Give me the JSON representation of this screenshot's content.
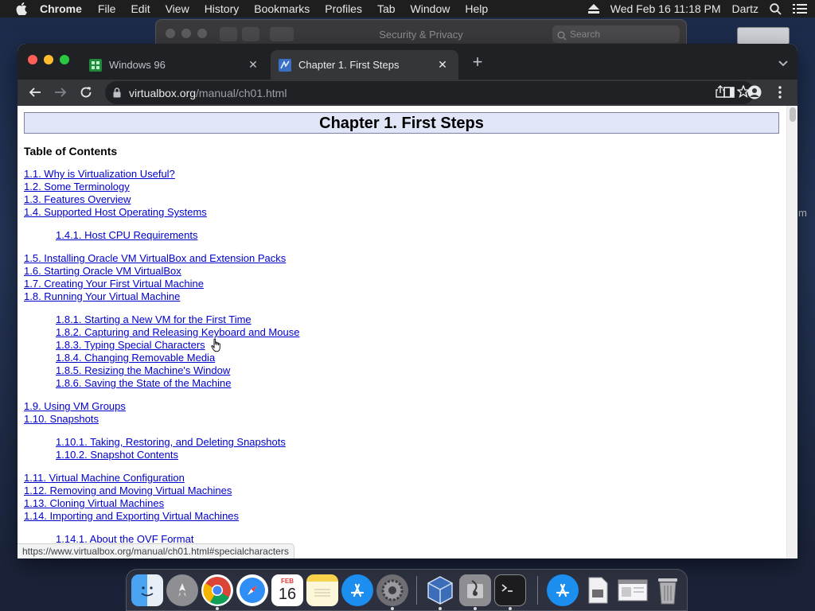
{
  "menubar": {
    "app_name": "Chrome",
    "menus": [
      "File",
      "Edit",
      "View",
      "History",
      "Bookmarks",
      "Profiles",
      "Tab",
      "Window",
      "Help"
    ],
    "datetime": "Wed Feb 16  11:18 PM",
    "user": "Dartz"
  },
  "background_window": {
    "title": "Security & Privacy",
    "search_placeholder": "Search"
  },
  "desktop": {
    "partial_text": "m"
  },
  "browser": {
    "tabs": [
      {
        "label": "Windows 96",
        "active": false
      },
      {
        "label": "Chapter 1. First Steps",
        "active": true
      }
    ],
    "url_host": "virtualbox.org",
    "url_path": "/manual/ch01.html",
    "status_url": "https://www.virtualbox.org/manual/ch01.html#specialcharacters"
  },
  "page": {
    "title": "Chapter 1. First Steps",
    "toc_heading": "Table of Contents",
    "toc": {
      "g1": [
        "1.1. Why is Virtualization Useful?",
        "1.2. Some Terminology",
        "1.3. Features Overview",
        "1.4. Supported Host Operating Systems"
      ],
      "g1_sub": [
        "1.4.1. Host CPU Requirements"
      ],
      "g2": [
        "1.5. Installing Oracle VM VirtualBox and Extension Packs",
        "1.6. Starting Oracle VM VirtualBox",
        "1.7. Creating Your First Virtual Machine",
        "1.8. Running Your Virtual Machine"
      ],
      "g2_sub": [
        "1.8.1. Starting a New VM for the First Time",
        "1.8.2. Capturing and Releasing Keyboard and Mouse",
        "1.8.3. Typing Special Characters",
        "1.8.4. Changing Removable Media",
        "1.8.5. Resizing the Machine's Window",
        "1.8.6. Saving the State of the Machine"
      ],
      "g3": [
        "1.9. Using VM Groups",
        "1.10. Snapshots"
      ],
      "g3_sub": [
        "1.10.1. Taking, Restoring, and Deleting Snapshots",
        "1.10.2. Snapshot Contents"
      ],
      "g4": [
        "1.11. Virtual Machine Configuration",
        "1.12. Removing and Moving Virtual Machines",
        "1.13. Cloning Virtual Machines",
        "1.14. Importing and Exporting Virtual Machines"
      ],
      "g4_sub": [
        "1.14.1. About the OVF Format"
      ]
    }
  },
  "dock": {
    "calendar_month": "FEB",
    "calendar_day": "16",
    "icons": [
      "finder-icon",
      "launchpad-icon",
      "chrome-icon",
      "safari-icon",
      "calendar-icon",
      "notes-icon",
      "app-store-icon",
      "system-preferences-icon",
      "virtualbox-icon",
      "disk-utility-icon",
      "terminal-icon",
      "app-store-folder-icon",
      "documents-icon",
      "screenshot-icon",
      "trash-icon"
    ]
  },
  "colors": {
    "link": "#0000cc",
    "title_bg": "#e0e6f8",
    "chrome_dark": "#202124",
    "chrome_tab_active": "#35363a"
  }
}
